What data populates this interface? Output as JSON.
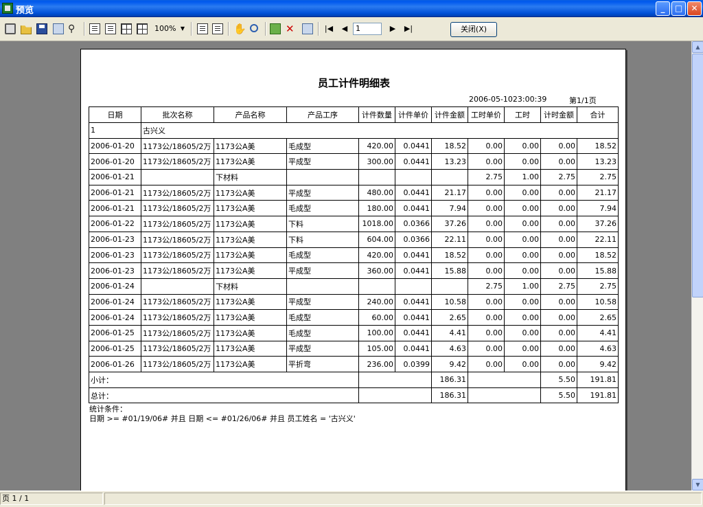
{
  "window": {
    "title": "预览"
  },
  "toolbar": {
    "zoom": "100%",
    "page_input": "1",
    "close_label": "关闭(X)"
  },
  "report": {
    "title": "员工计件明细表",
    "date": "2006-05-1023:00:39",
    "page": "第1/1页",
    "columns": [
      "日期",
      "批次名称",
      "产品名称",
      "产品工序",
      "计件数量",
      "计件单价",
      "计件金额",
      "工时单价",
      "工时",
      "计时金额",
      "合计"
    ],
    "group_no": "1",
    "group_name": "古兴义",
    "rows": [
      [
        "2006-01-20",
        "1173公/18605/2万",
        "1173公A美",
        "毛成型",
        "420.00",
        "0.0441",
        "18.52",
        "0.00",
        "0.00",
        "0.00",
        "18.52"
      ],
      [
        "2006-01-20",
        "1173公/18605/2万",
        "1173公A美",
        "平成型",
        "300.00",
        "0.0441",
        "13.23",
        "0.00",
        "0.00",
        "0.00",
        "13.23"
      ],
      [
        "2006-01-21",
        "",
        "下材料",
        "",
        "",
        "",
        "",
        "2.75",
        "1.00",
        "2.75",
        "2.75"
      ],
      [
        "2006-01-21",
        "1173公/18605/2万",
        "1173公A美",
        "平成型",
        "480.00",
        "0.0441",
        "21.17",
        "0.00",
        "0.00",
        "0.00",
        "21.17"
      ],
      [
        "2006-01-21",
        "1173公/18605/2万",
        "1173公A美",
        "毛成型",
        "180.00",
        "0.0441",
        "7.94",
        "0.00",
        "0.00",
        "0.00",
        "7.94"
      ],
      [
        "2006-01-22",
        "1173公/18605/2万",
        "1173公A美",
        "下料",
        "1018.00",
        "0.0366",
        "37.26",
        "0.00",
        "0.00",
        "0.00",
        "37.26"
      ],
      [
        "2006-01-23",
        "1173公/18605/2万",
        "1173公A美",
        "下料",
        "604.00",
        "0.0366",
        "22.11",
        "0.00",
        "0.00",
        "0.00",
        "22.11"
      ],
      [
        "2006-01-23",
        "1173公/18605/2万",
        "1173公A美",
        "毛成型",
        "420.00",
        "0.0441",
        "18.52",
        "0.00",
        "0.00",
        "0.00",
        "18.52"
      ],
      [
        "2006-01-23",
        "1173公/18605/2万",
        "1173公A美",
        "平成型",
        "360.00",
        "0.0441",
        "15.88",
        "0.00",
        "0.00",
        "0.00",
        "15.88"
      ],
      [
        "2006-01-24",
        "",
        "下材料",
        "",
        "",
        "",
        "",
        "2.75",
        "1.00",
        "2.75",
        "2.75"
      ],
      [
        "2006-01-24",
        "1173公/18605/2万",
        "1173公A美",
        "平成型",
        "240.00",
        "0.0441",
        "10.58",
        "0.00",
        "0.00",
        "0.00",
        "10.58"
      ],
      [
        "2006-01-24",
        "1173公/18605/2万",
        "1173公A美",
        "毛成型",
        "60.00",
        "0.0441",
        "2.65",
        "0.00",
        "0.00",
        "0.00",
        "2.65"
      ],
      [
        "2006-01-25",
        "1173公/18605/2万",
        "1173公A美",
        "毛成型",
        "100.00",
        "0.0441",
        "4.41",
        "0.00",
        "0.00",
        "0.00",
        "4.41"
      ],
      [
        "2006-01-25",
        "1173公/18605/2万",
        "1173公A美",
        "平成型",
        "105.00",
        "0.0441",
        "4.63",
        "0.00",
        "0.00",
        "0.00",
        "4.63"
      ],
      [
        "2006-01-26",
        "1173公/18605/2万",
        "1173公A美",
        "平折弯",
        "236.00",
        "0.0399",
        "9.42",
        "0.00",
        "0.00",
        "0.00",
        "9.42"
      ]
    ],
    "subtotal": {
      "label": "小计：",
      "piece_amount": "186.31",
      "time_amount": "5.50",
      "total": "191.81"
    },
    "grandtotal": {
      "label": "总计：",
      "piece_amount": "186.31",
      "time_amount": "5.50",
      "total": "191.81"
    },
    "conditions_label": "统计条件：",
    "conditions_text": "日期 >= #01/19/06# 并且 日期 <= #01/26/06# 并且 员工姓名 = '古兴义'"
  },
  "statusbar": {
    "page_text": "页 1 / 1"
  }
}
